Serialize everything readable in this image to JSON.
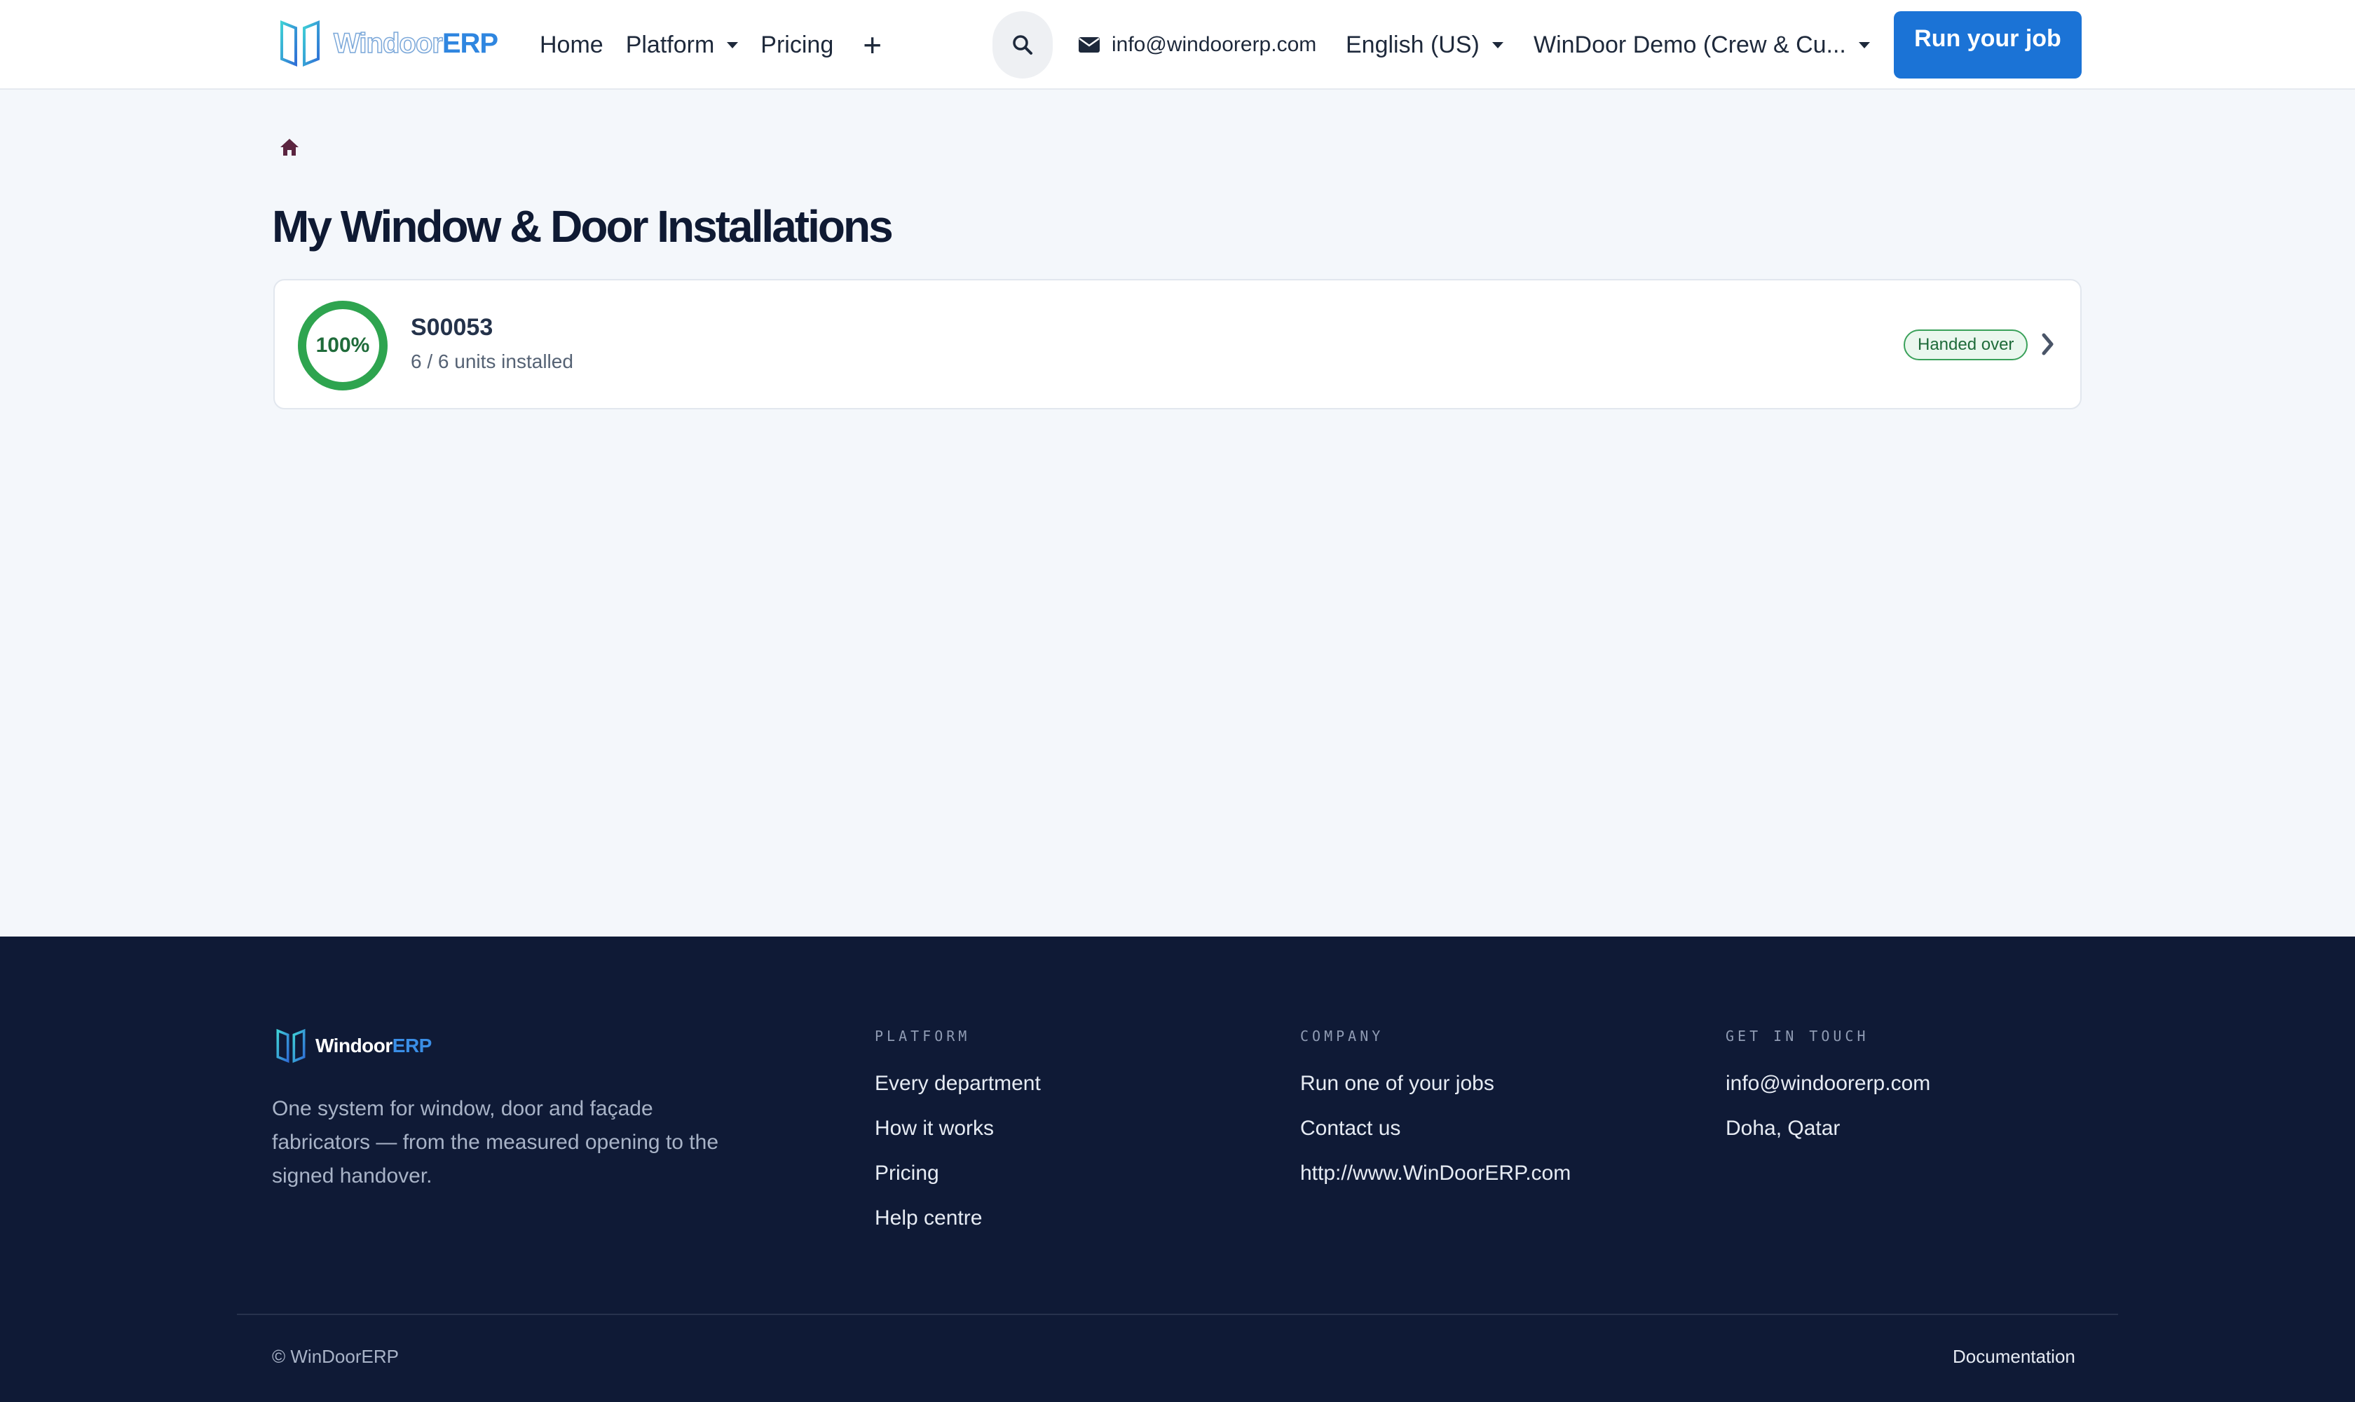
{
  "header": {
    "logo": {
      "word": "Windoor",
      "accent": "ERP"
    },
    "nav": [
      {
        "label": "Home"
      },
      {
        "label": "Platform"
      },
      {
        "label": "Pricing"
      }
    ],
    "more_icon": "plus-icon",
    "search_icon": "search-icon",
    "email": "info@windoorerp.com",
    "language": "English (US)",
    "company": "WinDoor Demo (Crew & Cu...",
    "cta_label": "Run your job"
  },
  "breadcrumb": {
    "icon": "home-icon"
  },
  "page_title": "My Window & Door Installations",
  "installations": [
    {
      "progress_percent": 100,
      "progress_label": "100%",
      "reference": "S00053",
      "units_text": "6 / 6 units installed",
      "status": "Handed over"
    }
  ],
  "footer": {
    "logo": {
      "word": "Windoor",
      "accent": "ERP"
    },
    "description": "One system for window, door and façade fabricators — from the measured opening to the signed handover.",
    "columns": [
      {
        "heading": "Platform",
        "links": [
          "Every department",
          "How it works",
          "Pricing",
          "Help centre"
        ]
      },
      {
        "heading": "Company",
        "links": [
          "Run one of your jobs",
          "Contact us",
          "http://www.WinDoorERP.com"
        ]
      },
      {
        "heading": "Get in touch",
        "links": [
          "info@windoorerp.com",
          "Doha, Qatar"
        ]
      }
    ],
    "copyright": "© WinDoorERP",
    "documentation": "Documentation"
  },
  "colors": {
    "primary": "#1b73d6",
    "success": "#2ea44f",
    "footer_bg": "#0f1a36",
    "page_bg": "#f4f7fb"
  }
}
